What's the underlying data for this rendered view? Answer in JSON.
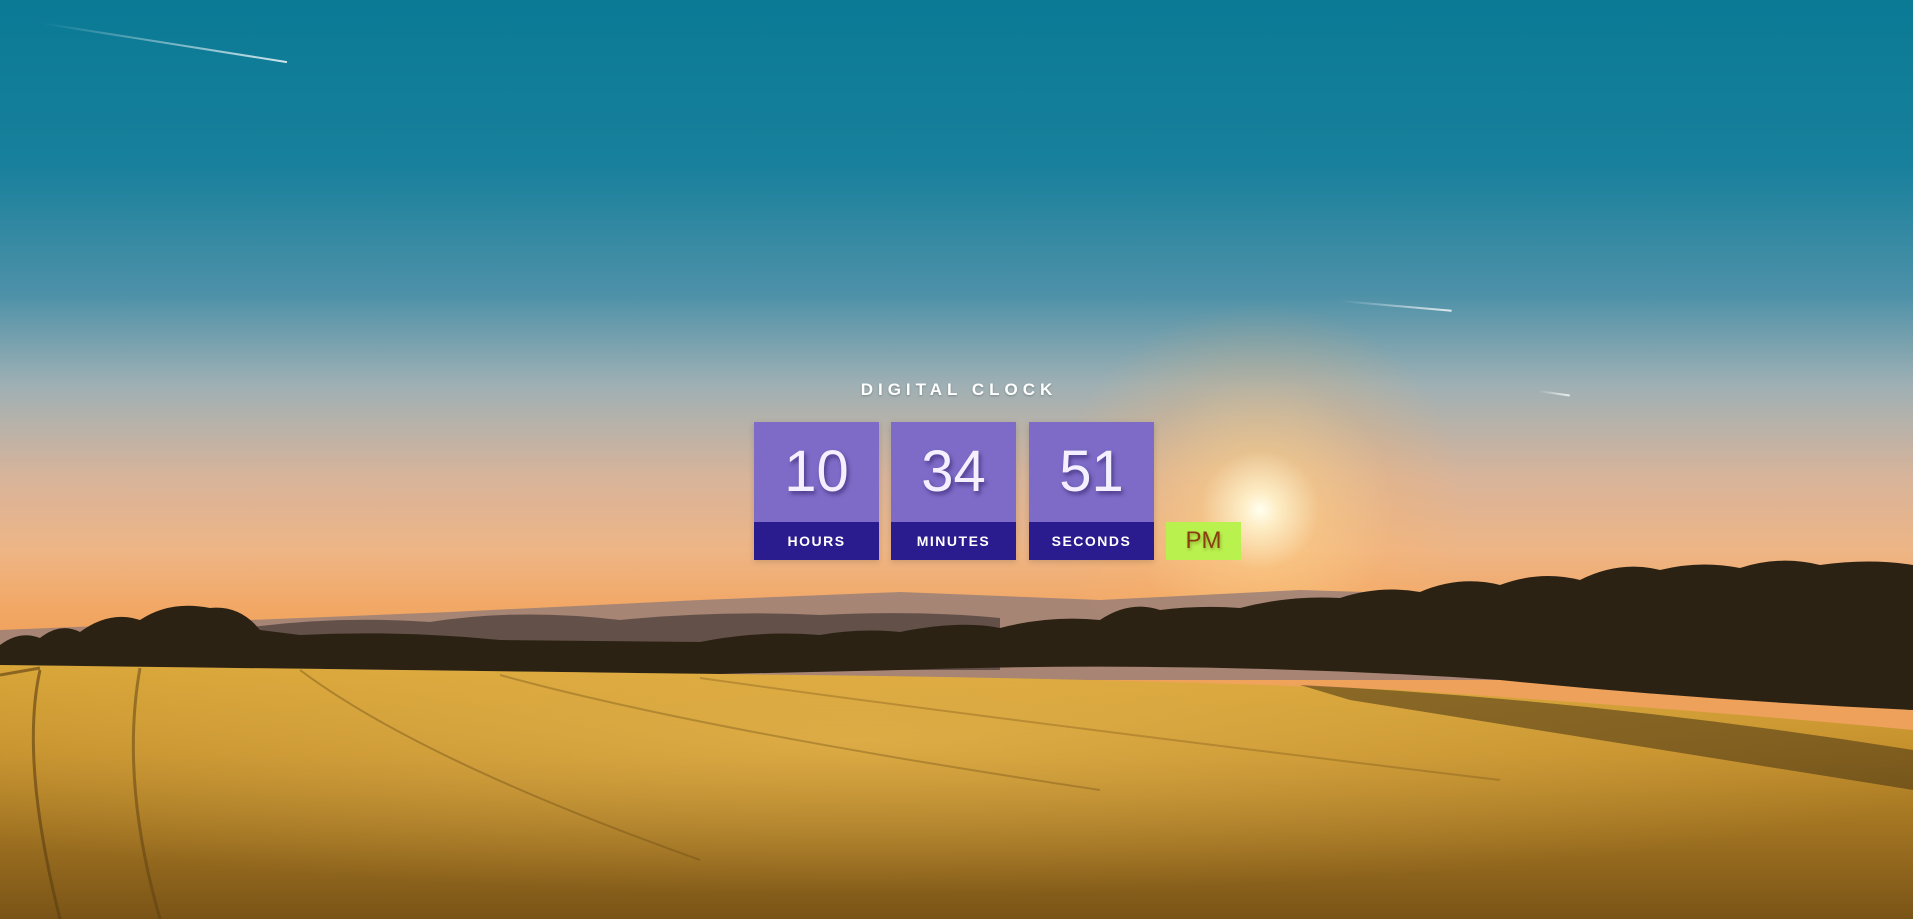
{
  "clock": {
    "title": "DIGITAL CLOCK",
    "hours": "10",
    "minutes": "34",
    "seconds": "51",
    "hours_label": "HOURS",
    "minutes_label": "MINUTES",
    "seconds_label": "SECONDS",
    "period": "PM"
  },
  "colors": {
    "number_box": "#7d6bc7",
    "label_box": "#2a1c8e",
    "period_box": "#b9f24e",
    "period_text": "#8a3e10"
  }
}
